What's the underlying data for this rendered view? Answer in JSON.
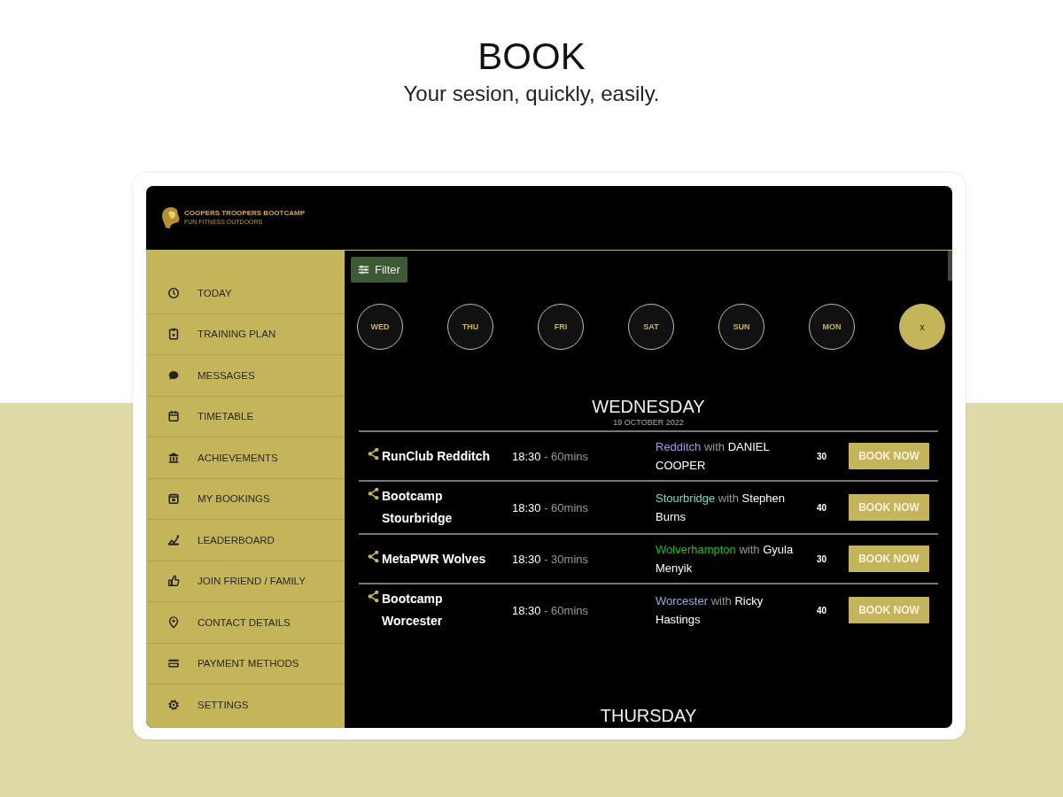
{
  "headline": {
    "title": "BOOK",
    "subtitle": "Your sesion, quickly, easily."
  },
  "app": {
    "logo": {
      "name": "COOPERS TROOPERS BOOTCAMP",
      "tagline": "FUN FITNESS OUTDOORS"
    },
    "sidebar": {
      "items": [
        {
          "label": "TODAY"
        },
        {
          "label": "TRAINING PLAN"
        },
        {
          "label": "MESSAGES"
        },
        {
          "label": "TIMETABLE"
        },
        {
          "label": "ACHIEVEMENTS"
        },
        {
          "label": "MY BOOKINGS"
        },
        {
          "label": "LEADERBOARD"
        },
        {
          "label": "JOIN FRIEND / FAMILY"
        },
        {
          "label": "CONTACT DETAILS"
        },
        {
          "label": "PAYMENT METHODS"
        },
        {
          "label": "SETTINGS"
        }
      ]
    },
    "filter_button": {
      "label": "Filter"
    },
    "days": [
      {
        "label": "WED",
        "kind": "day"
      },
      {
        "label": "THU",
        "kind": "day"
      },
      {
        "label": "FRI",
        "kind": "day"
      },
      {
        "label": "SAT",
        "kind": "day"
      },
      {
        "label": "SUN",
        "kind": "day"
      },
      {
        "label": "MON",
        "kind": "day"
      },
      {
        "label": "x",
        "kind": "close"
      }
    ],
    "schedule": [
      {
        "day": "WEDNESDAY",
        "date": "19 OCTOBER 2022",
        "sessions": [
          {
            "name": "RunClub Redditch",
            "time": "18:30",
            "duration": "- 60mins",
            "location": "Redditch",
            "color": "#b48ee6",
            "with": "with",
            "coach": "DANIEL COOPER",
            "spaces": "30",
            "button": "BOOK NOW"
          },
          {
            "name": "Bootcamp Stourbridge",
            "time": "18:30",
            "duration": "- 60mins",
            "location": "Stourbridge",
            "color": "#7fd6c4",
            "with": "with",
            "coach": "Stephen Burns",
            "spaces": "40",
            "button": "BOOK NOW"
          },
          {
            "name": "MetaPWR Wolves",
            "time": "18:30",
            "duration": "- 30mins",
            "location": "Wolverhampton",
            "color": "#1fbf1f",
            "with": "with",
            "coach": "Gyula Menyik",
            "spaces": "30",
            "button": "BOOK NOW"
          },
          {
            "name": "Bootcamp Worcester",
            "time": "18:30",
            "duration": "- 60mins",
            "location": "Worcester",
            "color": "#8caee0",
            "with": "with",
            "coach": "Ricky Hastings",
            "spaces": "40",
            "button": "BOOK NOW"
          }
        ]
      },
      {
        "day": "THURSDAY"
      }
    ]
  }
}
